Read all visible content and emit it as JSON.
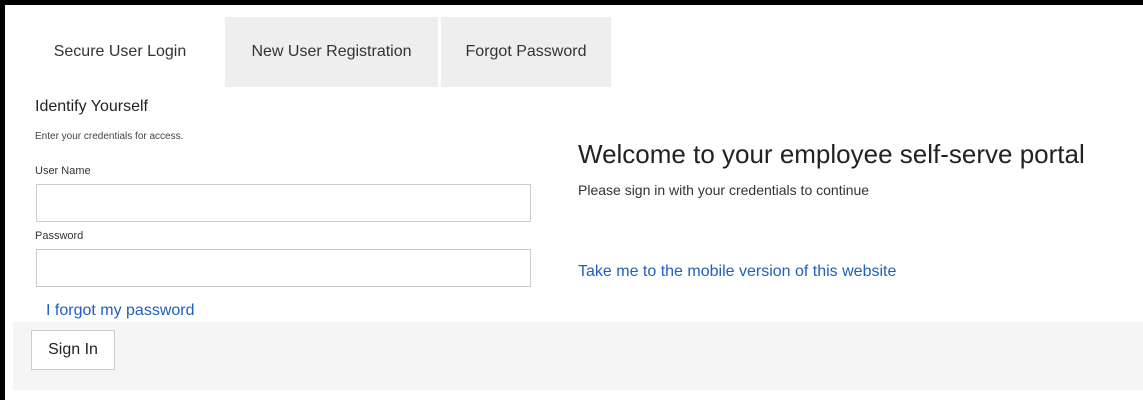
{
  "tabs": [
    {
      "label": "Secure User Login",
      "active": true
    },
    {
      "label": "New User Registration",
      "active": false
    },
    {
      "label": "Forgot Password",
      "active": false
    }
  ],
  "login": {
    "heading": "Identify Yourself",
    "subtext": "Enter your credentials for access.",
    "username_label": "User Name",
    "username_value": "",
    "password_label": "Password",
    "password_value": "",
    "forgot_link": "I forgot my password",
    "signin_label": "Sign In"
  },
  "welcome": {
    "title": "Welcome to your employee self-serve portal",
    "subtitle": "Please sign in with your credentials to continue",
    "mobile_link": "Take me to the mobile version of this website"
  },
  "colors": {
    "link": "#1f5fbf",
    "tab_inactive_bg": "#eeeeee",
    "footer_bg": "#f5f5f5",
    "border": "#000000"
  }
}
